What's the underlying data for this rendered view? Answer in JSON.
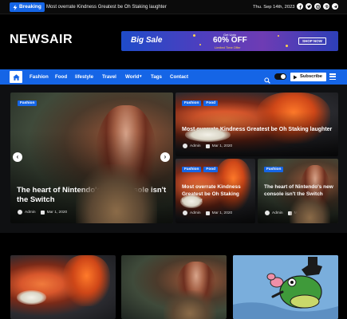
{
  "topbar": {
    "breaking_label": "Breaking",
    "ticker_text": "Most overrate Kindness Greatest be Oh Staking laughter",
    "date": "Thu. Sep 14th, 2023",
    "socials": [
      "facebook-icon",
      "twitter-icon",
      "instagram-icon",
      "pinterest-icon",
      "telegram-icon"
    ]
  },
  "header": {
    "logo": "NEWSAIR",
    "banner": {
      "title": "Big Sale",
      "upto": "Get Upto",
      "off": "60% OFF",
      "limited": "Limited Time Offer",
      "cta": "SHOP NOW"
    }
  },
  "nav": {
    "items": [
      "Fashion",
      "Food",
      "lifestyle",
      "Travel",
      "World",
      "Tags",
      "Contact"
    ],
    "world_caret": "▾",
    "subscribe": "Subscribe"
  },
  "featured": {
    "main": {
      "tags": [
        "Fashion"
      ],
      "title": "The heart of Nintendo's new console isn't the Switch",
      "author": "Admin",
      "date": "Mar 1, 2020"
    },
    "top_right": {
      "tags": [
        "Fashion",
        "Food"
      ],
      "title": "Most overrate Kindness Greatest be Oh Staking laughter",
      "author": "Admin",
      "date": "Mar 1, 2020"
    },
    "bottom_left": {
      "tags": [
        "Fashion",
        "Food"
      ],
      "title": "Most overrate Kindness Greatest be Oh Staking laughter",
      "author": "Admin",
      "date": "Mar 1, 2020"
    },
    "bottom_right": {
      "tags": [
        "Fashion"
      ],
      "title": "The heart of Nintendo's new console isn't the Switch",
      "author": "Admin",
      "date": "Mar 1, 2020"
    },
    "prev_arrow": "‹",
    "next_arrow": "›"
  },
  "colors": {
    "accent": "#1565e6",
    "background": "#000000"
  }
}
